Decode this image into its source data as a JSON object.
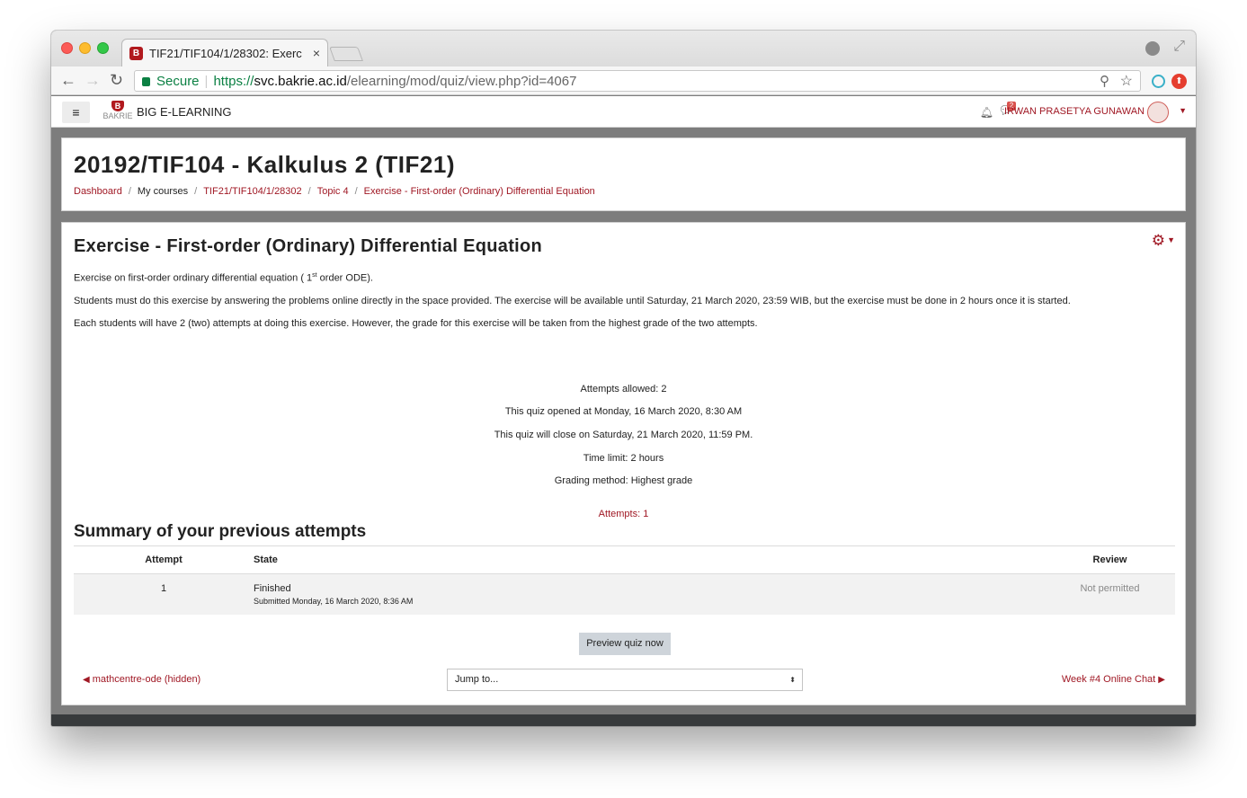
{
  "browser": {
    "tab_title": "TIF21/TIF104/1/28302: Exerc",
    "tab_favicon": "B",
    "tab_close": "×",
    "secure_label": "Secure",
    "url_proto": "https://",
    "url_host": "svc.bakrie.ac.id",
    "url_path": "/elearning/mod/quiz/view.php?id=4067",
    "icons": [
      "back-icon",
      "forward-icon",
      "reload-icon",
      "lock-icon",
      "zoom-icon",
      "star-icon",
      "profile-icon",
      "fullscreen-icon"
    ]
  },
  "navbar": {
    "menu_icon": "≡",
    "logo_mark": "B",
    "logo_text": "BAKRIE",
    "site_name": "BIG E-LEARNING",
    "message_count": "2",
    "user_name": "IRWAN PRASETYA GUNAWAN"
  },
  "header": {
    "title": "20192/TIF104 - Kalkulus 2 (TIF21)",
    "breadcrumb": [
      "Dashboard",
      "My courses",
      "TIF21/TIF104/1/28302",
      "Topic 4",
      "Exercise - First-order (Ordinary) Differential Equation"
    ]
  },
  "main": {
    "activity_title": "Exercise - First-order (Ordinary) Differential Equation",
    "intro_1_before": "Exercise on first-order ordinary differential equation ( 1",
    "intro_1_sup": "st",
    "intro_1_after": " order ODE).",
    "intro_2": "Students must do this exercise by answering the problems online directly in the space provided. The exercise will be available until Saturday, 21 March 2020, 23:59 WIB, but the exercise must be done in 2 hours once it is started.",
    "intro_3": "Each students will have 2 (two) attempts at doing this exercise. However, the grade for this exercise will be taken from the highest grade of the two attempts.",
    "info": {
      "attempts_allowed": "Attempts allowed: 2",
      "opened": "This quiz opened at Monday, 16 March 2020, 8:30 AM",
      "close": "This quiz will close on Saturday, 21 March 2020, 11:59 PM.",
      "time_limit": "Time limit: 2 hours",
      "grading": "Grading method: Highest grade",
      "attempts_link": "Attempts: 1"
    },
    "summary_title": "Summary of your previous attempts",
    "table": {
      "headers": [
        "Attempt",
        "State",
        "Review"
      ],
      "rows": [
        {
          "attempt": "1",
          "state": "Finished",
          "submitted": "Submitted Monday, 16 March 2020, 8:36 AM",
          "review": "Not permitted"
        }
      ]
    },
    "preview_button": "Preview quiz now",
    "prev_link": "mathcentre-ode (hidden)",
    "next_link": "Week #4 Online Chat",
    "jump_placeholder": "Jump to..."
  }
}
